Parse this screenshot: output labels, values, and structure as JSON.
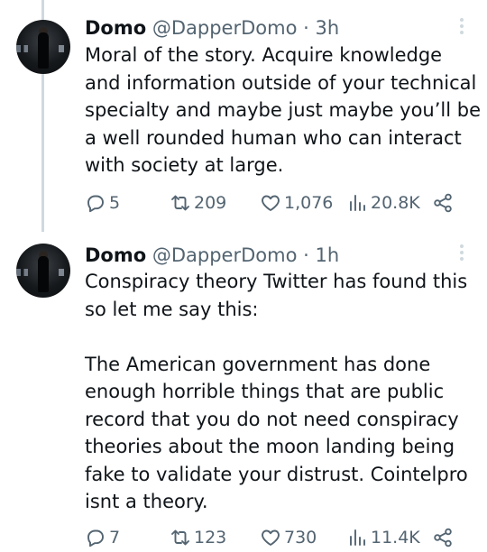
{
  "tweets": [
    {
      "name": "Domo",
      "handle": "@DapperDomo",
      "separator": "·",
      "time": "3h",
      "text": "Moral of the story. Acquire knowledge\nand information outside of your technical\nspecialty and maybe just maybe you’ll be\na well rounded human who can interact\nwith society at large.",
      "replies": "5",
      "retweets": "209",
      "likes": "1,076",
      "views": "20.8K"
    },
    {
      "name": "Domo",
      "handle": "@DapperDomo",
      "separator": "·",
      "time": "1h",
      "text": "Conspiracy theory Twitter has found this\nso let me say this:\n\nThe American government has done\nenough horrible things that are public\nrecord that you do not need conspiracy\ntheories about the moon landing being\nfake to validate your distrust. Cointelpro\nisnt a theory.",
      "replies": "7",
      "retweets": "123",
      "likes": "730",
      "views": "11.4K"
    }
  ],
  "icons": {
    "reply": "reply-icon",
    "retweet": "retweet-icon",
    "like": "heart-icon",
    "views": "views-icon",
    "share": "share-icon",
    "more": "more-vertical-icon"
  },
  "colors": {
    "text": "#0f1419",
    "secondary": "#536471",
    "thread_line": "#cfd9de"
  }
}
